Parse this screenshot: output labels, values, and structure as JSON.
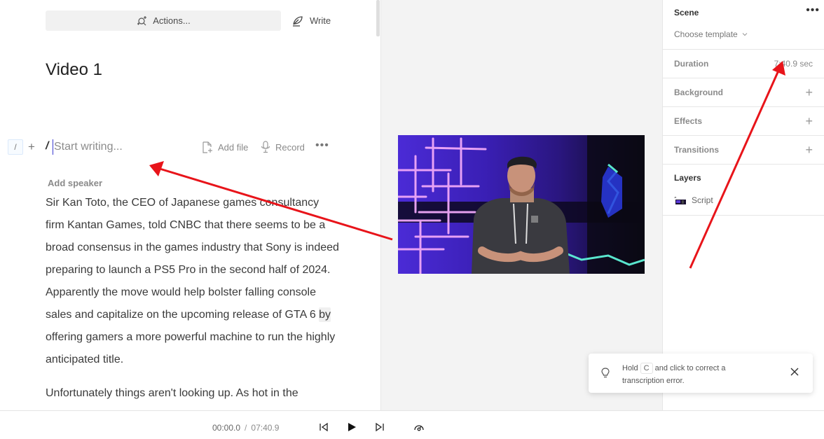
{
  "toolbar": {
    "actions_label": "Actions...",
    "write_label": "Write"
  },
  "document": {
    "title": "Video 1",
    "slash_badge": "/",
    "plus_label": "+",
    "slash_mark": "/",
    "placeholder": "Start writing...",
    "add_file_label": "Add file",
    "record_label": "Record",
    "more_label": "•••",
    "add_speaker_label": "Add speaker",
    "paragraph1": {
      "before_highlight": "Sir Kan Toto, the CEO of Japanese games consultancy firm Kantan Games, told CNBC that there seems to be a broad consensus in the games industry that Sony is indeed preparing to launch a PS5 Pro in the second half of 2024. Apparently the move would help bolster falling console sales and capitalize on the upcoming release of GTA 6 ",
      "highlight": "by",
      "after_highlight": " offering gamers a more powerful machine to run the highly anticipated title."
    },
    "paragraph2": "Unfortunately things aren't looking up. As hot in the"
  },
  "scene_panel": {
    "scene_title": "Scene",
    "more_label": "•••",
    "template_label": "Choose template",
    "duration_label": "Duration",
    "duration_value": "7:40.9 sec",
    "rows": [
      {
        "label": "Background",
        "action": "+"
      },
      {
        "label": "Effects",
        "action": "+"
      },
      {
        "label": "Transitions",
        "action": "+"
      }
    ],
    "layers_title": "Layers",
    "layers": [
      {
        "label": "Script"
      }
    ]
  },
  "toast": {
    "text_before": "Hold",
    "key": "C",
    "text_after": "and click to correct a transcription error."
  },
  "player": {
    "current_time": "00:00.0",
    "separator": "/",
    "total_time": "07:40.9"
  },
  "annotations": {
    "color": "#e8141a"
  },
  "colors": {
    "cursor": "#3b3bd0",
    "video_bg": "#3a1c9e",
    "neon_pink": "#f2a6f5",
    "neon_cyan": "#5ef2d8"
  }
}
